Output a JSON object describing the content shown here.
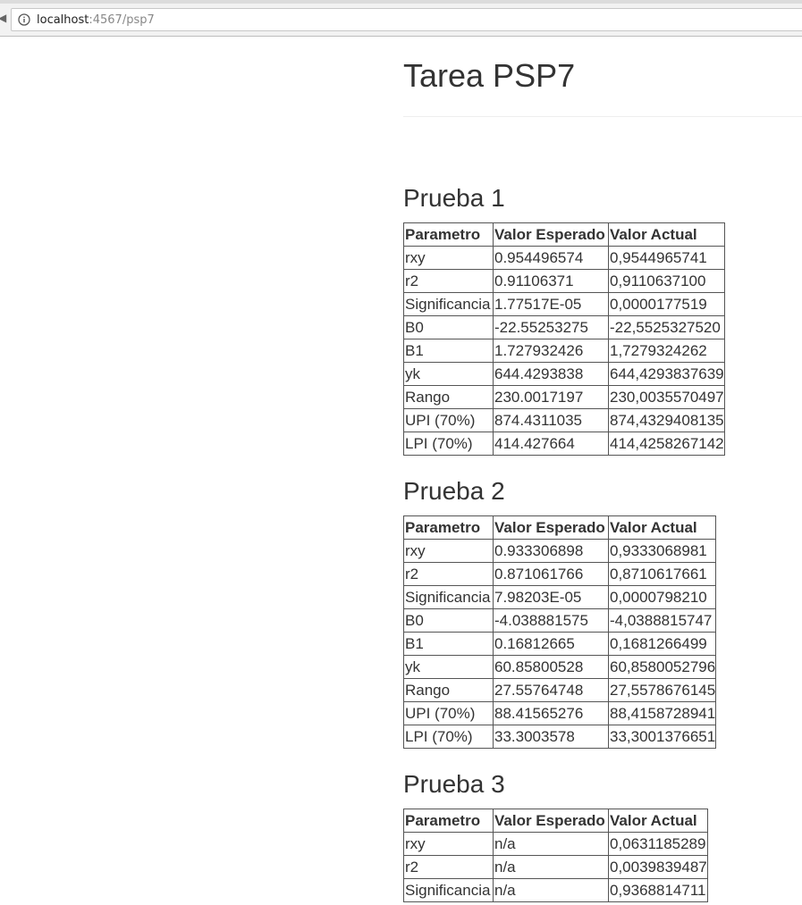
{
  "browser": {
    "url_host": "localhost",
    "url_rest": ":4567/psp7"
  },
  "page": {
    "title": "Tarea PSP7"
  },
  "table_headers": [
    "Parametro",
    "Valor Esperado",
    "Valor Actual"
  ],
  "tests": [
    {
      "title": "Prueba 1",
      "rows": [
        [
          "rxy",
          "0.954496574",
          "0,9544965741"
        ],
        [
          "r2",
          "0.91106371",
          "0,9110637100"
        ],
        [
          "Significancia",
          "1.77517E-05",
          "0,0000177519"
        ],
        [
          "B0",
          "-22.55253275",
          "-22,5525327520"
        ],
        [
          "B1",
          "1.727932426",
          "1,7279324262"
        ],
        [
          "yk",
          "644.4293838",
          "644,4293837639"
        ],
        [
          "Rango",
          "230.0017197",
          "230,0035570497"
        ],
        [
          "UPI (70%)",
          "874.4311035",
          "874,4329408135"
        ],
        [
          "LPI (70%)",
          "414.427664",
          "414,4258267142"
        ]
      ]
    },
    {
      "title": "Prueba 2",
      "rows": [
        [
          "rxy",
          "0.933306898",
          "0,9333068981"
        ],
        [
          "r2",
          "0.871061766",
          "0,8710617661"
        ],
        [
          "Significancia",
          "7.98203E-05",
          "0,0000798210"
        ],
        [
          "B0",
          "-4.038881575",
          "-4,0388815747"
        ],
        [
          "B1",
          "0.16812665",
          "0,1681266499"
        ],
        [
          "yk",
          "60.85800528",
          "60,8580052796"
        ],
        [
          "Rango",
          "27.55764748",
          "27,5578676145"
        ],
        [
          "UPI (70%)",
          "88.41565276",
          "88,4158728941"
        ],
        [
          "LPI (70%)",
          "33.3003578",
          "33,3001376651"
        ]
      ]
    },
    {
      "title": "Prueba 3",
      "rows": [
        [
          "rxy",
          "n/a",
          "0,0631185289"
        ],
        [
          "r2",
          "n/a",
          "0,0039839487"
        ],
        [
          "Significancia",
          "n/a",
          "0,9368814711"
        ]
      ]
    }
  ]
}
